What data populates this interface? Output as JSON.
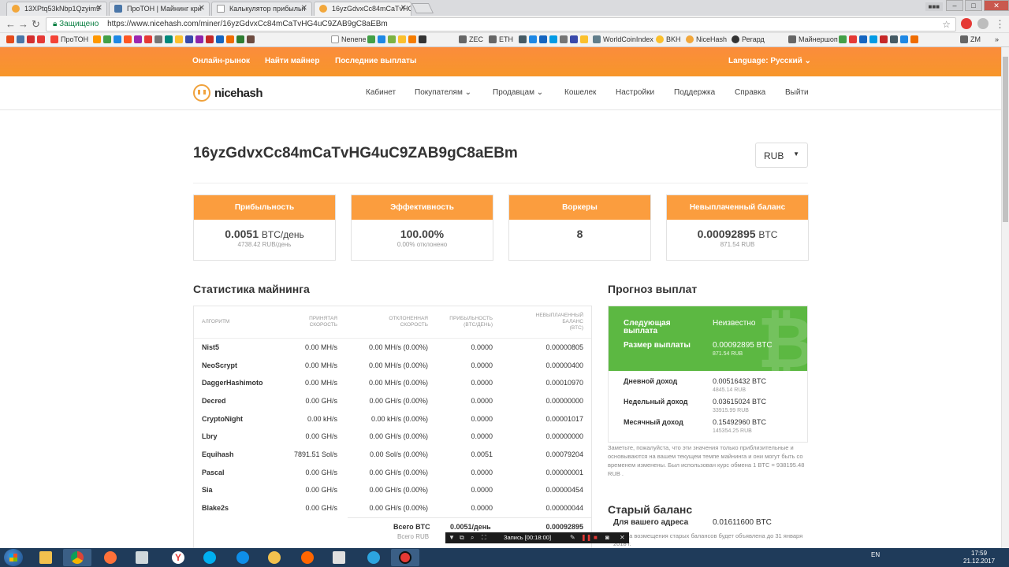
{
  "browser": {
    "tabs": [
      {
        "label": "13XPtq53kNbp1Qzyim9",
        "active": false
      },
      {
        "label": "ПроТОН | Майнинг кри",
        "active": false
      },
      {
        "label": "Калькулятор прибыльн",
        "active": false
      },
      {
        "label": "16yzGdvxCc84mCaTvHG",
        "active": true
      }
    ],
    "url": "https://www.nicehash.com/miner/16yzGdvxCc84mCaTvHG4uC9ZAB9gC8aEBm",
    "secure_label": "Защищено",
    "bookmarks": [
      "ПроТОН",
      "Nenene",
      "ZEC",
      "ETH",
      "WorldCoinIndex",
      "BKH",
      "NiceHash",
      "Регард",
      "Майнершоп",
      "ZM"
    ]
  },
  "topbar": {
    "links": [
      "Онлайн-рынок",
      "Найти майнер",
      "Последние выплаты"
    ],
    "language": "Language: Русский"
  },
  "nav": {
    "logo": "nicehash",
    "links": [
      "Кабинет",
      "Покупателям",
      "Продавцам",
      "Кошелек",
      "Настройки",
      "Поддержка",
      "Справка",
      "Выйти"
    ]
  },
  "page": {
    "address": "16yzGdvxCc84mCaTvHG4uC9ZAB9gC8aEBm",
    "currency": "RUB"
  },
  "cards": [
    {
      "title": "Прибыльность",
      "value": "0.0051",
      "unit": "BTC/день",
      "sub": "4738.42 RUB/день"
    },
    {
      "title": "Эффективность",
      "value": "100.00%",
      "unit": "",
      "sub": "0.00% отклонено"
    },
    {
      "title": "Воркеры",
      "value": "8",
      "unit": "",
      "sub": ""
    },
    {
      "title": "Невыплаченный баланс",
      "value": "0.00092895",
      "unit": "BTC",
      "sub": "871.54 RUB"
    }
  ],
  "stats": {
    "title": "Статистика майнинга",
    "headers": {
      "alg": "АЛГОРИТМ",
      "acc1": "ПРИНЯТАЯ",
      "acc2": "СКОРОСТЬ",
      "rej1": "ОТКЛОНЕННАЯ",
      "rej2": "СКОРОСТЬ",
      "prof1": "ПРИБЫЛЬНОСТЬ",
      "prof2": "(BTC/ДЕНЬ)",
      "bal1": "НЕВЫПЛАЧЕННЫЙ",
      "bal2": "БАЛАНС",
      "bal3": "(BTC)"
    },
    "rows": [
      {
        "alg": "Nist5",
        "acc": "0.00 MH/s",
        "rej": "0.00 MH/s (0.00%)",
        "prof": "0.0000",
        "bal": "0.00000805"
      },
      {
        "alg": "NeoScrypt",
        "acc": "0.00 MH/s",
        "rej": "0.00 MH/s (0.00%)",
        "prof": "0.0000",
        "bal": "0.00000400"
      },
      {
        "alg": "DaggerHashimoto",
        "acc": "0.00 MH/s",
        "rej": "0.00 MH/s (0.00%)",
        "prof": "0.0000",
        "bal": "0.00010970"
      },
      {
        "alg": "Decred",
        "acc": "0.00 GH/s",
        "rej": "0.00 GH/s (0.00%)",
        "prof": "0.0000",
        "bal": "0.00000000"
      },
      {
        "alg": "CryptoNight",
        "acc": "0.00 kH/s",
        "rej": "0.00 kH/s (0.00%)",
        "prof": "0.0000",
        "bal": "0.00001017"
      },
      {
        "alg": "Lbry",
        "acc": "0.00 GH/s",
        "rej": "0.00 GH/s (0.00%)",
        "prof": "0.0000",
        "bal": "0.00000000"
      },
      {
        "alg": "Equihash",
        "acc": "7891.51 Sol/s",
        "rej": "0.00 Sol/s (0.00%)",
        "prof": "0.0051",
        "bal": "0.00079204"
      },
      {
        "alg": "Pascal",
        "acc": "0.00 GH/s",
        "rej": "0.00 GH/s (0.00%)",
        "prof": "0.0000",
        "bal": "0.00000001"
      },
      {
        "alg": "Sia",
        "acc": "0.00 GH/s",
        "rej": "0.00 GH/s (0.00%)",
        "prof": "0.0000",
        "bal": "0.00000454"
      },
      {
        "alg": "Blake2s",
        "acc": "0.00 GH/s",
        "rej": "0.00 GH/s (0.00%)",
        "prof": "0.0000",
        "bal": "0.00000044"
      }
    ],
    "total_label": "Всего BTC",
    "total_prof": "0.0051/день",
    "total_bal": "0.00092895",
    "total_rub_label": "Всего RUB"
  },
  "forecast": {
    "title": "Прогноз выплат",
    "next_label": "Следующая выплата",
    "next_value": "Неизвестно",
    "size_label": "Размер выплаты",
    "size_value": "0.00092895 BTC",
    "size_rub": "871.54 RUB",
    "daily_label": "Дневной доход",
    "daily_btc": "0.00516432 BTC",
    "daily_rub": "4845.14 RUB",
    "weekly_label": "Недельный доход",
    "weekly_btc": "0.03615024 BTC",
    "weekly_rub": "33915.99 RUB",
    "monthly_label": "Месячный доход",
    "monthly_btc": "0.15492960 BTC",
    "monthly_rub": "145354.25 RUB",
    "note": "Заметьте, пожалуйста, что эти значения только приблизительные и основываются на вашем текущем темпе майнинга и они могут быть со временем изменены. Был использован курс обмена 1 BTC = 938195.48 RUB ."
  },
  "old_balance": {
    "title": "Старый баланс",
    "label": "Для вашего адреса",
    "value": "0.01611600 BTC",
    "note": "... дата возмещения старых балансов будет объявлена до 31 января 2018 г."
  },
  "recorder": {
    "label": "Запись [00:18:00]"
  },
  "taskbar": {
    "lang": "EN",
    "time": "17:59",
    "date": "21.12.2017"
  }
}
